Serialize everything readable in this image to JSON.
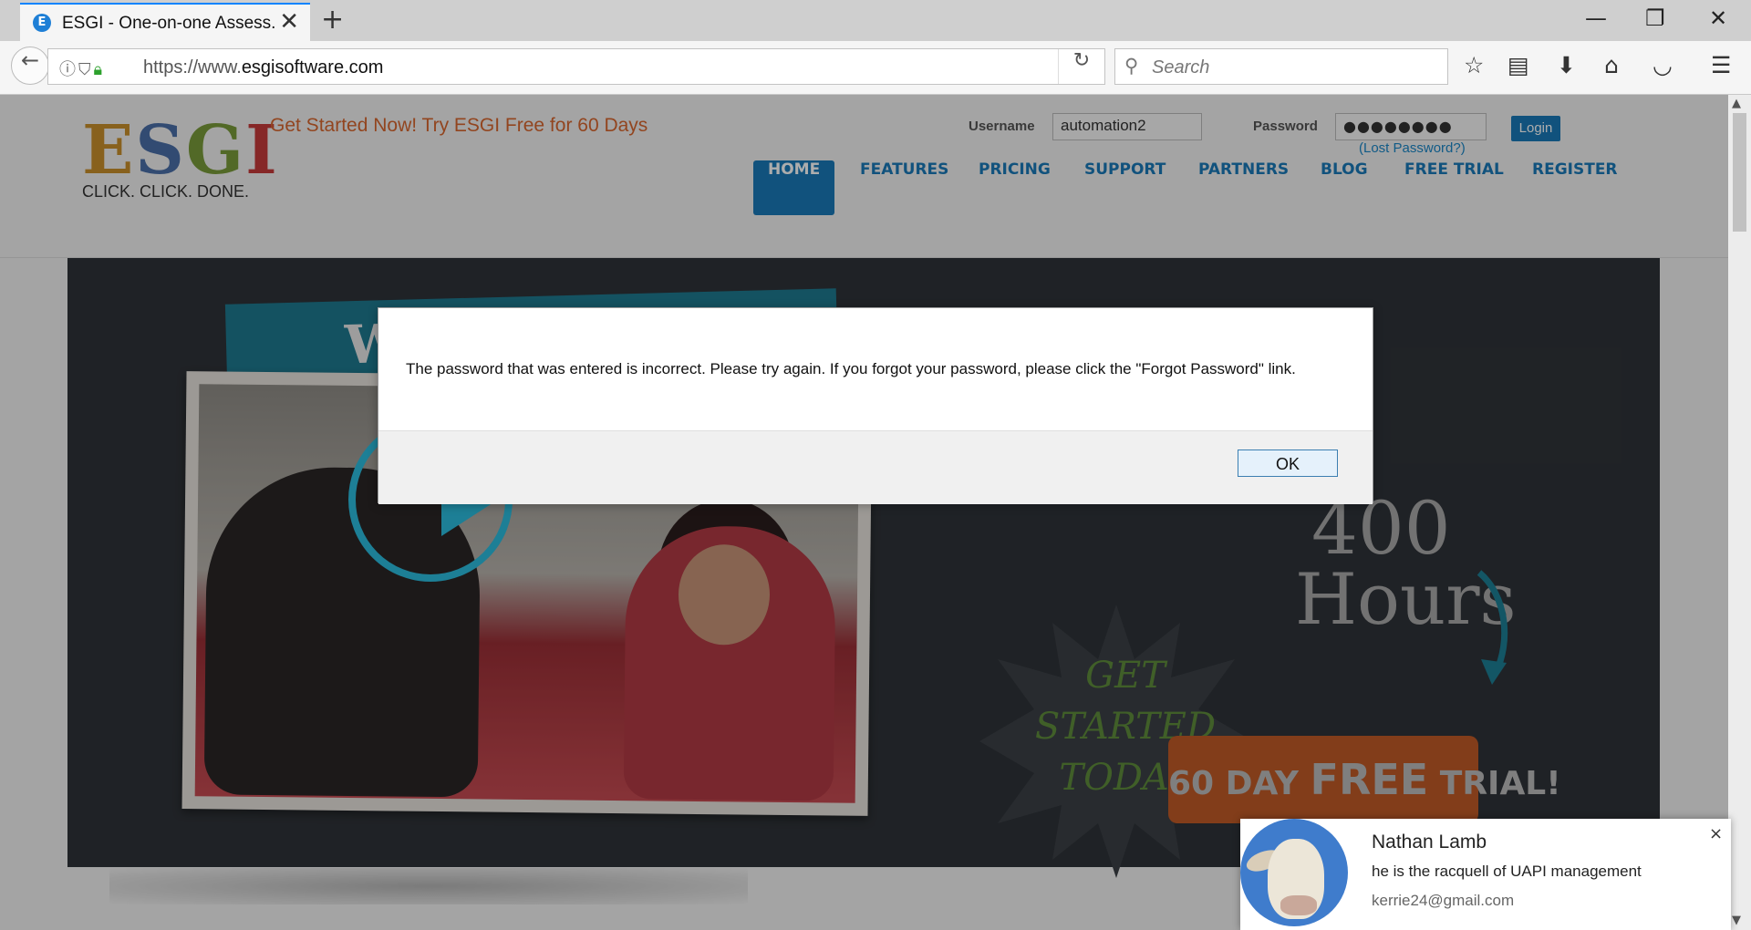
{
  "browser": {
    "tab_title": "ESGI - One-on-one Assess...",
    "tab_favicon": "E",
    "tab_close": "✕",
    "new_tab": "+",
    "minimize": "—",
    "restore": "❐",
    "close": "✕",
    "back": "←",
    "url_prefix": "https://www.",
    "url_domain": "esgisoftware.com",
    "search_placeholder": "Search",
    "toolbar_icons": [
      "bookmark-star-icon",
      "reading-list-icon",
      "downloads-icon",
      "home-icon",
      "pocket-icon",
      "menu-icon"
    ]
  },
  "header": {
    "logo_letters": [
      "E",
      "S",
      "G",
      "I"
    ],
    "logo_tagline": "CLICK. CLICK. DONE.",
    "promo": "Get Started Now! Try ESGI Free for 60 Days",
    "username_label": "Username",
    "username_value": "automation2",
    "password_label": "Password",
    "password_value": "●●●●●●●●",
    "lost_password": "(Lost Password?)",
    "login_label": "Login",
    "nav": [
      "HOME",
      "FEATURES",
      "PRICING",
      "SUPPORT",
      "PARTNERS",
      "BLOG",
      "FREE TRIAL",
      "REGISTER"
    ],
    "nav_active": "HOME"
  },
  "hero": {
    "banner_letter": "W",
    "badge_lines": [
      "GET",
      "STARTED",
      "TODAY"
    ],
    "hours_number": "400",
    "hours_word": "Hours",
    "trial_prefix": "60 DAY ",
    "trial_free": "FREE",
    "trial_suffix": " TRIAL!"
  },
  "dialog": {
    "message": "The password that was entered is incorrect. Please try again. If you forgot your password, please click the \"Forgot Password\" link.",
    "ok_label": "OK"
  },
  "notification": {
    "name": "Nathan Lamb",
    "body": "he is the racquell of UAPI management",
    "email": "kerrie24@gmail.com",
    "close": "×"
  },
  "colors": {
    "accent_blue": "#1a7ab8",
    "promo_orange": "#d8662e",
    "trial_orange": "#c05a27",
    "badge_green": "#5f8c3b"
  }
}
